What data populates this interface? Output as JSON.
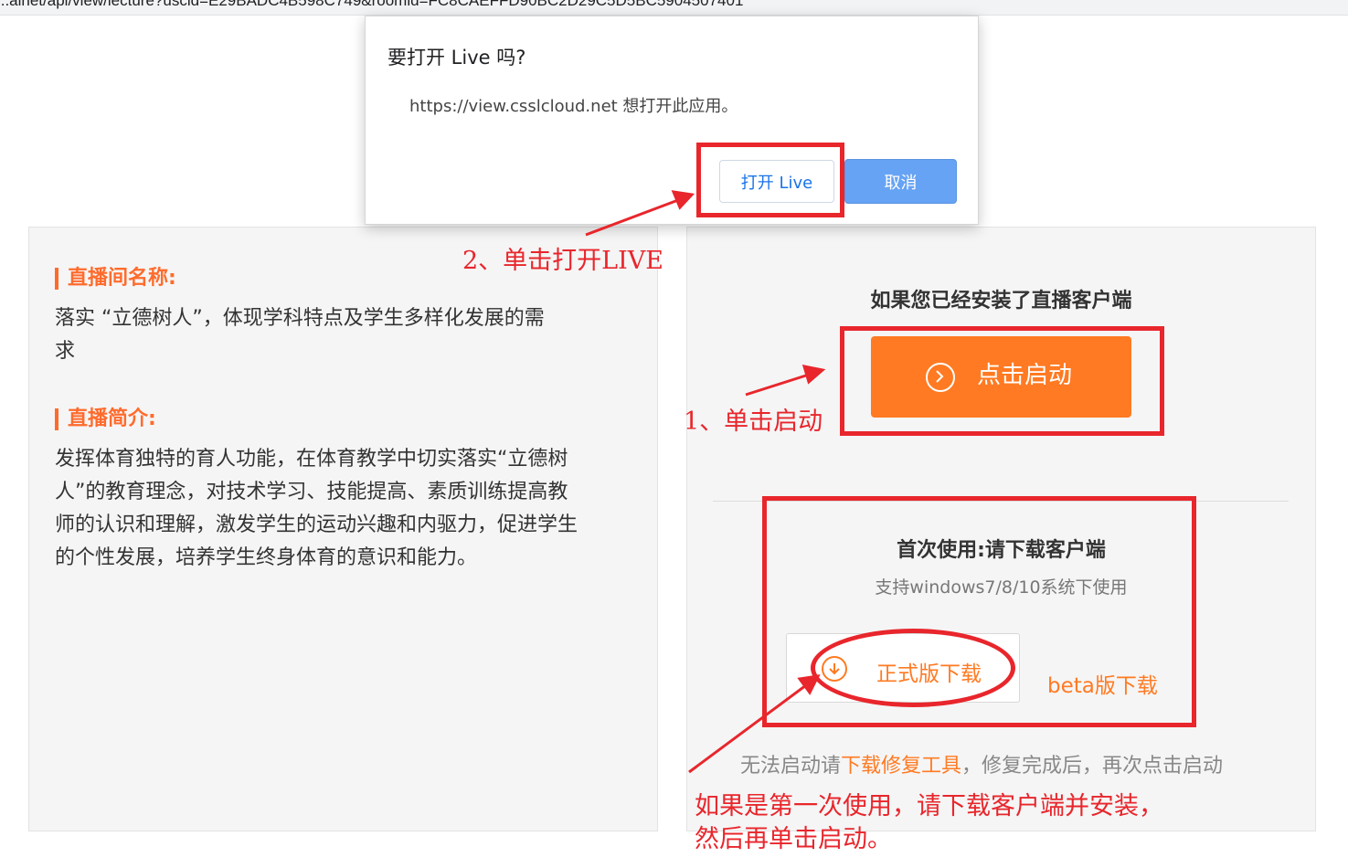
{
  "browser": {
    "url_visible": "...alnet/api/view/lecture?uscid=E29BADC4B598C749&roomid=FC8CAEFFD90BC2D29C5D5BC5904507401"
  },
  "dialog": {
    "title": "要打开 Live 吗?",
    "message": "https://view.csslcloud.net 想打开此应用。",
    "open_button": "打开 Live",
    "cancel_button": "取消"
  },
  "left_panel": {
    "room_name_label": "直播间名称:",
    "room_name_line1": "落实 “立德树人”，体现学科特点及学生多样化发展的需",
    "room_name_line2": "求",
    "intro_label": "直播简介:",
    "intro_lines": [
      "发挥体育独特的育人功能，在体育教学中切实落实“立德树",
      "人”的教育理念，对技术学习、技能提高、素质训练提高教",
      "师的认识和理解，激发学生的运动兴趣和内驱力，促进学生",
      "的个性发展，培养学生终身体育的意识和能力。"
    ]
  },
  "right_panel": {
    "installed_title": "如果您已经安装了直播客户端",
    "launch_button": "点击启动",
    "first_use_title": "首次使用:请下载客户端",
    "support_text": "支持windows7/8/10系统下使用",
    "download_button": "正式版下载",
    "beta_link": "beta版下载",
    "repair_prefix": "无法启动请",
    "repair_link": "下载修复工具",
    "repair_suffix": "，修复完成后，再次点击启动"
  },
  "annotations": {
    "step1": "1、单击启动",
    "step2": "2、单击打开LIVE",
    "note_line1": "如果是第一次使用，请下载客户端并安装，",
    "note_line2": "然后再单击启动。",
    "color": "#e8262c"
  },
  "colors": {
    "accent": "#ff7a22",
    "dialog_primary": "#66a3f4"
  }
}
